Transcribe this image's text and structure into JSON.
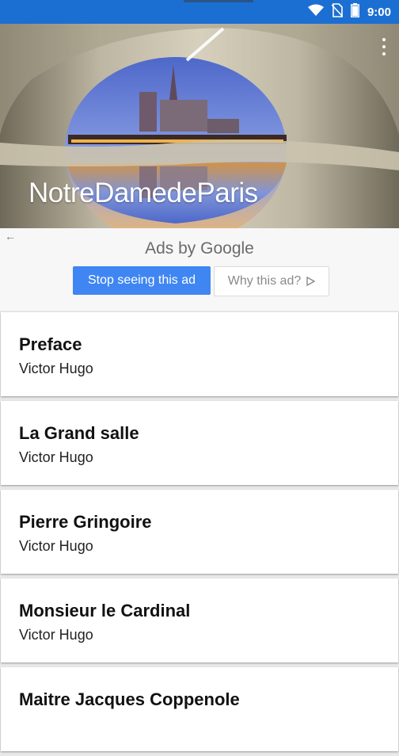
{
  "status_bar": {
    "time": "9:00",
    "icons": [
      "wifi-icon",
      "no-sim-icon",
      "battery-icon"
    ]
  },
  "hero": {
    "title": "NotreDamedeParis",
    "menu_icon": "overflow-menu-icon"
  },
  "ad": {
    "ads_by": "Ads by Google",
    "stop_label": "Stop seeing this ad",
    "why_label": "Why this ad?",
    "back_icon": "back-arrow-icon"
  },
  "chapters": [
    {
      "title": "Preface",
      "author": "Victor Hugo"
    },
    {
      "title": "La Grand salle",
      "author": "Victor Hugo"
    },
    {
      "title": "Pierre Gringoire",
      "author": "Victor Hugo"
    },
    {
      "title": "Monsieur le Cardinal",
      "author": "Victor Hugo"
    },
    {
      "title": "Maitre Jacques Coppenole",
      "author": ""
    }
  ],
  "colors": {
    "status_bar": "#1c6fd2",
    "ad_button": "#3f86f2"
  }
}
